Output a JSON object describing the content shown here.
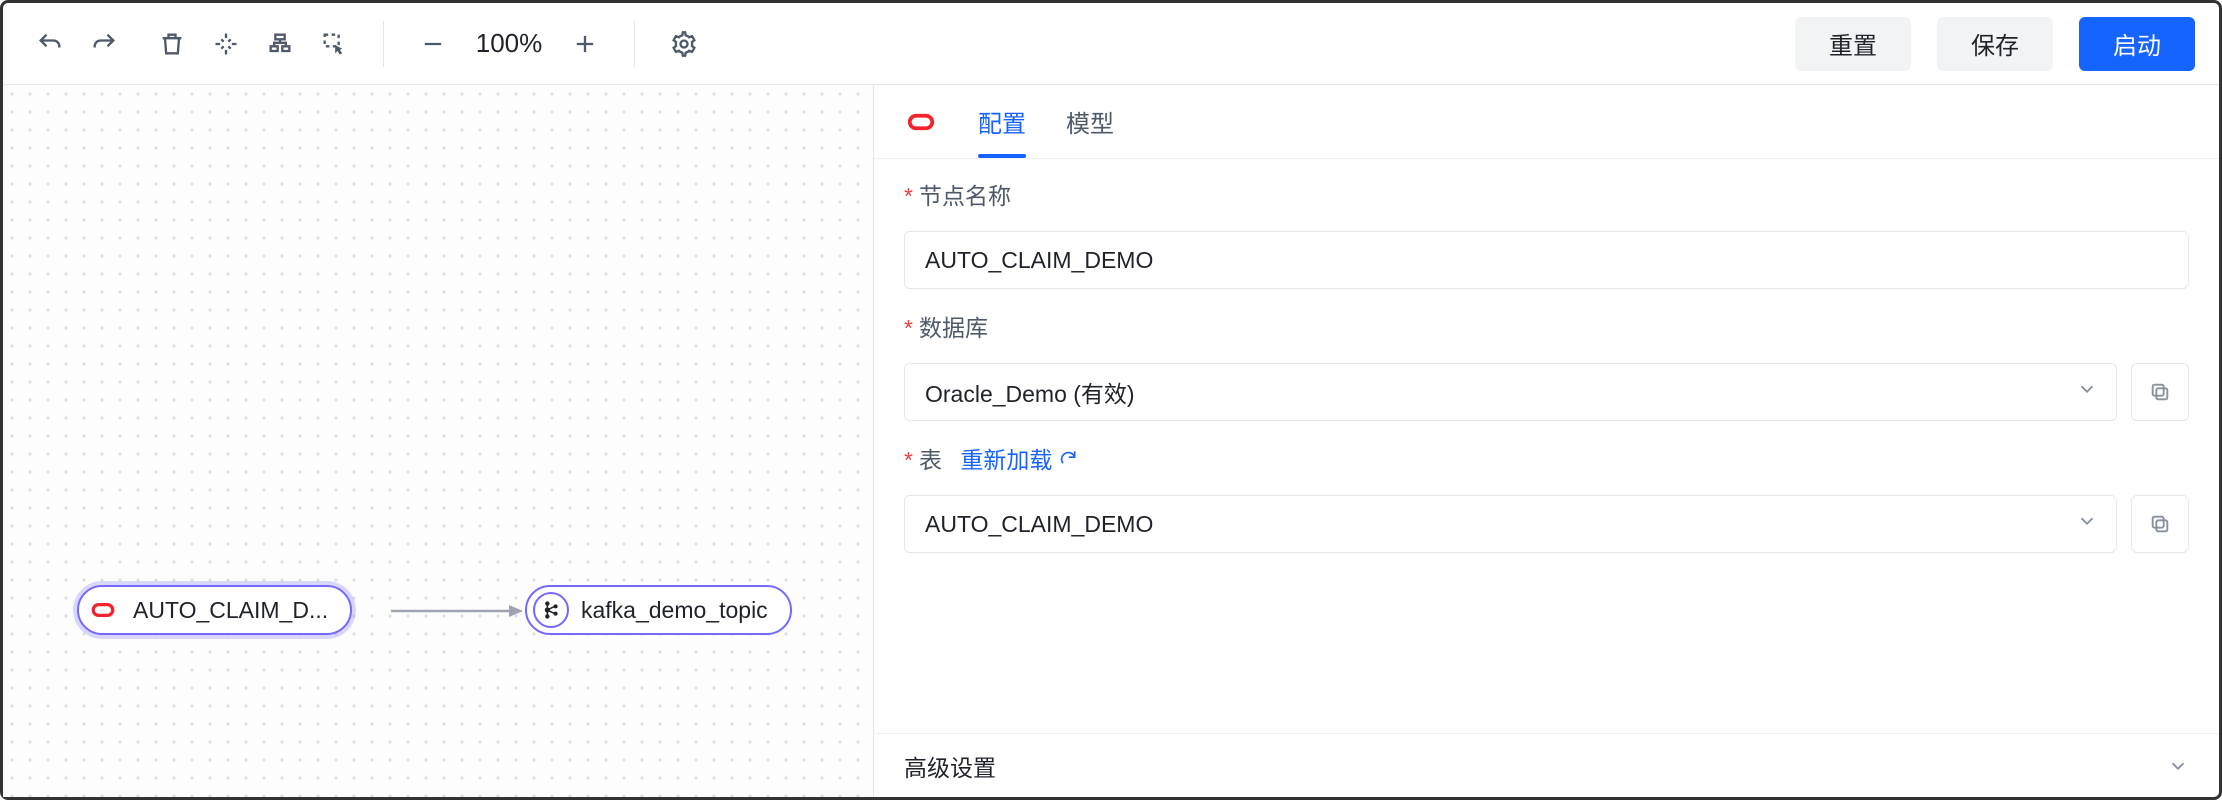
{
  "toolbar": {
    "zoom_label": "100%",
    "reset_label": "重置",
    "save_label": "保存",
    "start_label": "启动"
  },
  "canvas": {
    "source_node": {
      "label": "AUTO_CLAIM_D...",
      "icon": "oracle"
    },
    "target_node": {
      "label": "kafka_demo_topic",
      "icon": "kafka"
    }
  },
  "panel": {
    "tabs": {
      "config": "配置",
      "model": "模型"
    },
    "node_name": {
      "label": "节点名称",
      "value": "AUTO_CLAIM_DEMO"
    },
    "database": {
      "label": "数据库",
      "value": "Oracle_Demo (有效)"
    },
    "table": {
      "label": "表",
      "reload_label": "重新加载",
      "value": "AUTO_CLAIM_DEMO"
    },
    "advanced_label": "高级设置"
  }
}
